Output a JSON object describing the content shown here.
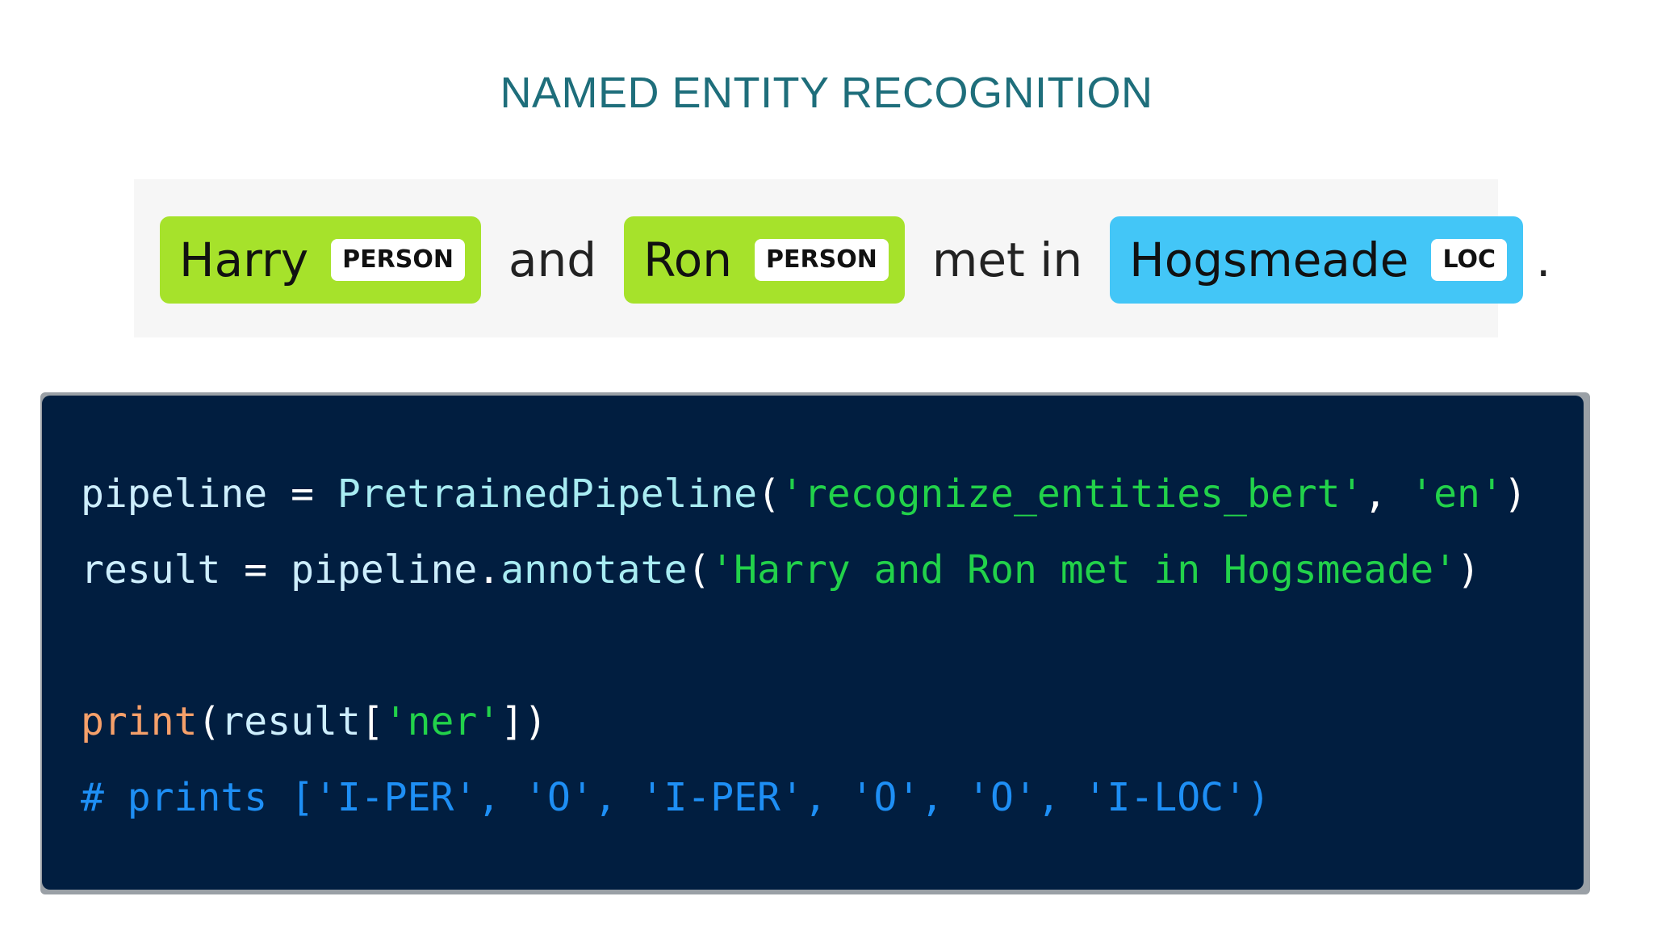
{
  "title": "NAMED ENTITY RECOGNITION",
  "colors": {
    "title": "#1e6e7b",
    "person_entity": "#a6e22b",
    "loc_entity": "#43c6f7",
    "code_background": "#011e40",
    "string": "#22d24a",
    "comment": "#1e8ff5",
    "keyword": "#f6a06a"
  },
  "ner_example": {
    "entity_1": {
      "text": "Harry",
      "label": "PERSON"
    },
    "word_1": "and",
    "entity_2": {
      "text": "Ron",
      "label": "PERSON"
    },
    "word_2": "met in",
    "entity_3": {
      "text": "Hogsmeade",
      "label": "LOC"
    },
    "end": "."
  },
  "code": {
    "line1": {
      "var": "pipeline",
      "op": " = ",
      "fn": "PretrainedPipeline",
      "open": "(",
      "arg1": "'recognize_entities_bert'",
      "sep": ", ",
      "arg2": "'en'",
      "close": ")"
    },
    "line2": {
      "var": "result",
      "op": " = ",
      "obj": "pipeline",
      "dot": ".",
      "method": "annotate",
      "open": "(",
      "arg": "'Harry and Ron met in Hogsmeade'",
      "close": ")"
    },
    "line3": {
      "fn": "print",
      "open": "(",
      "var": "result",
      "bracket_open": "[",
      "key": "'ner'",
      "close": "])"
    },
    "line4": {
      "comment": "# prints ['I-PER', 'O', 'I-PER', 'O', 'O', 'I-LOC')"
    }
  }
}
